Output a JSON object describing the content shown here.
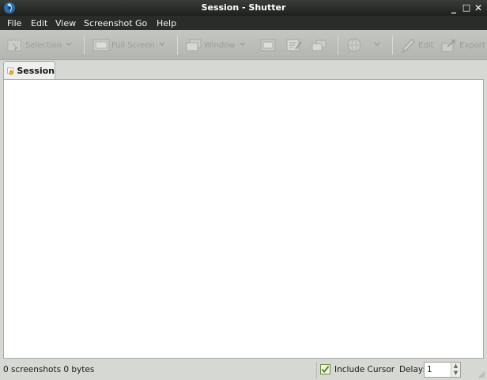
{
  "window": {
    "title": "Session - Shutter"
  },
  "menu": {
    "items": [
      "File",
      "Edit",
      "View",
      "Screenshot",
      "Go",
      "Help"
    ]
  },
  "toolbar": {
    "selection_label": "Selection",
    "fullscreen_label": "Full Screen",
    "window_label": "Window",
    "edit_label": "Edit",
    "export_label": "Export"
  },
  "tabs": [
    {
      "label": "Session"
    }
  ],
  "status": {
    "summary": "0 screenshots  0 bytes",
    "include_cursor_label": "Include Cursor",
    "include_cursor_checked": true,
    "delay_label": "Delay:",
    "delay_value": "1"
  },
  "colors": {
    "titlebar": "#1e201e",
    "menubar": "#2a2c2a",
    "toolbar": "#b8bab5",
    "content": "#ffffff",
    "check": "#4f8a2a"
  }
}
